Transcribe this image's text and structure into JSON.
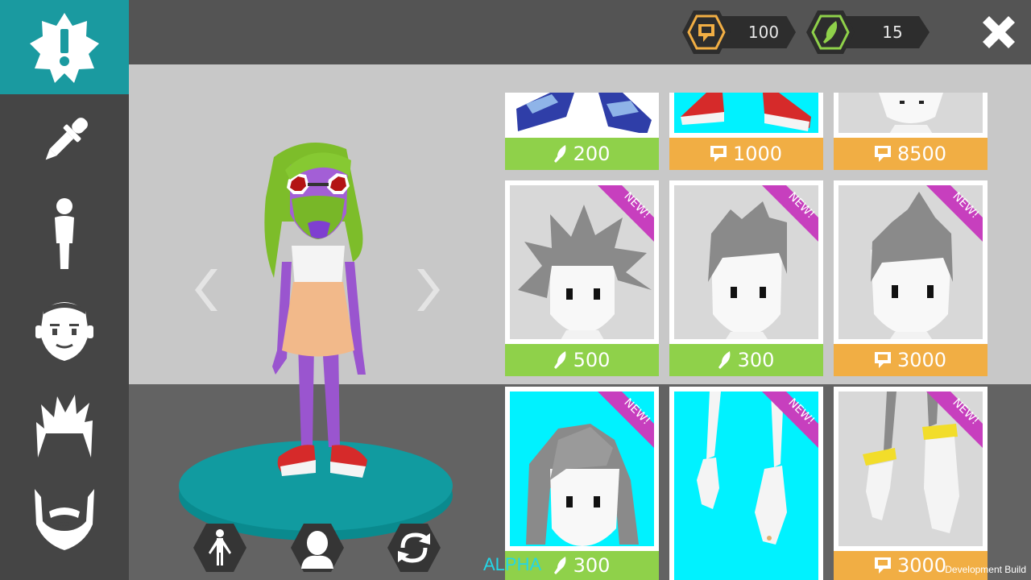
{
  "currencies": {
    "tokens": {
      "value": "100",
      "icon": "chat-token-icon",
      "color": "#f1ae44"
    },
    "feathers": {
      "value": "15",
      "icon": "feather-icon",
      "color": "#8fd14a"
    }
  },
  "sidebar": {
    "items": [
      {
        "icon": "alert-badge-icon"
      },
      {
        "icon": "eyedropper-icon"
      },
      {
        "icon": "body-icon"
      },
      {
        "icon": "face-icon"
      },
      {
        "icon": "hair-icon"
      },
      {
        "icon": "beard-icon"
      }
    ]
  },
  "colors": {
    "accent": "#1a9aa0",
    "green_price": "#8fd14a",
    "orange_price": "#f1ae44",
    "new_ribbon": "#c73fbe",
    "cyan_bg": "#00f2ff"
  },
  "shop": {
    "tiles": [
      {
        "name": "tile-blue-sneakers",
        "price": "200",
        "currency": "feather",
        "new": false
      },
      {
        "name": "tile-red-sneakers",
        "price": "1000",
        "currency": "token",
        "new": false
      },
      {
        "name": "tile-face",
        "price": "8500",
        "currency": "token",
        "new": false
      },
      {
        "name": "tile-spiky-hair",
        "price": "500",
        "currency": "feather",
        "new": true,
        "ribbon": "NEW!"
      },
      {
        "name": "tile-swept-hair",
        "price": "300",
        "currency": "feather",
        "new": true,
        "ribbon": "NEW!"
      },
      {
        "name": "tile-mohawk-hair",
        "price": "3000",
        "currency": "token",
        "new": true,
        "ribbon": "NEW!"
      },
      {
        "name": "tile-long-hair",
        "price": "300",
        "currency": "feather",
        "new": true,
        "ribbon": "NEW!"
      },
      {
        "name": "tile-white-gloves",
        "price": "",
        "currency": "",
        "new": true,
        "ribbon": "NEW!"
      },
      {
        "name": "tile-gold-bracer-gloves",
        "price": "3000",
        "currency": "token",
        "new": true,
        "ribbon": "NEW!"
      }
    ]
  },
  "footer": {
    "alpha": "ALPHA",
    "dev_build": "Development Build"
  }
}
